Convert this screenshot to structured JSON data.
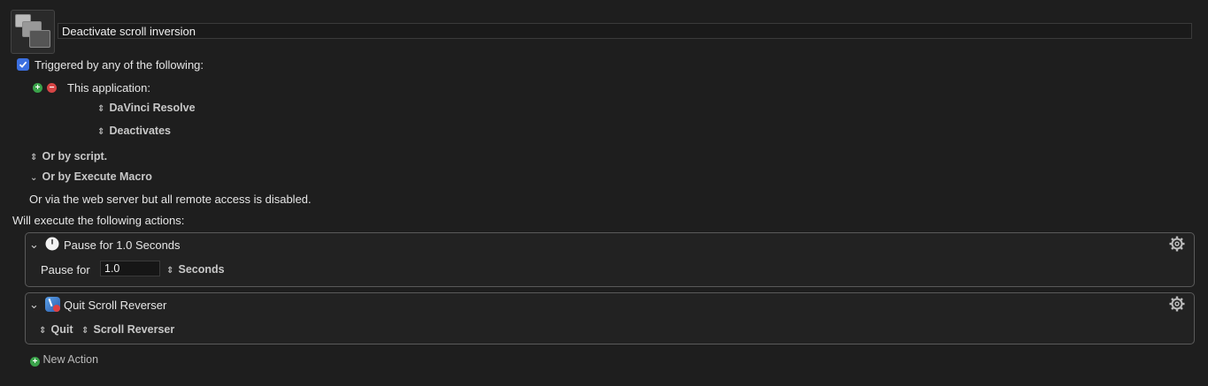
{
  "macro": {
    "name": "Deactivate scroll inversion"
  },
  "triggers": {
    "header_label": "Triggered by any of the following:",
    "checked": true,
    "app_trigger_label": "This application:",
    "app_name": "DaVinci Resolve",
    "app_event": "Deactivates",
    "or_by_script": "Or by script.",
    "or_by_execute_macro": "Or by Execute Macro",
    "web_server_note": "Or via the web server but all remote access is disabled."
  },
  "actions": {
    "header_label": "Will execute the following actions:",
    "items": [
      {
        "title": "Pause for 1.0 Seconds",
        "icon": "clock-icon",
        "field_label": "Pause for",
        "field_value": "1.0",
        "unit": "Seconds"
      },
      {
        "title": "Quit Scroll Reverser",
        "icon": "quit-app-icon",
        "verb": "Quit",
        "target_app": "Scroll Reverser"
      }
    ],
    "new_action_label": "New Action"
  },
  "colors": {
    "background": "#1e1e1e",
    "checkbox_blue": "#3b6fe0",
    "add_green": "#3aa34a",
    "remove_red": "#d64545"
  }
}
